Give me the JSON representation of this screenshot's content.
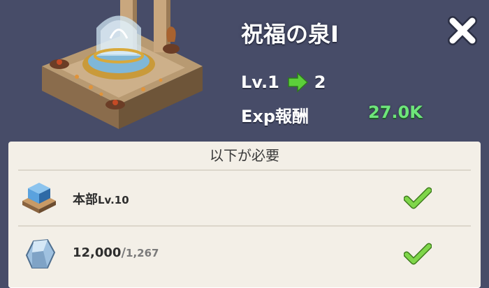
{
  "building": {
    "name": "祝福の泉Ⅰ",
    "level_from": "Lv.1",
    "level_to": "2",
    "exp_label": "Exp報酬",
    "exp_value": "27.0K"
  },
  "requirements": {
    "title": "以下が必要",
    "items": [
      {
        "name": "本部",
        "level": "Lv.10",
        "met": true,
        "icon": "headquarters-icon"
      },
      {
        "have": "12,000",
        "separator": "/",
        "need": "1,267",
        "met": true,
        "icon": "stone-resource-icon"
      }
    ]
  },
  "colors": {
    "background": "#474c68",
    "panel": "#f3efe7",
    "exp_value": "#6ee67a",
    "check": "#6cc23a"
  },
  "icons": {
    "close": "close-icon",
    "arrow": "green-arrow-icon",
    "check": "checkmark-icon",
    "building": "fountain-building-icon"
  }
}
